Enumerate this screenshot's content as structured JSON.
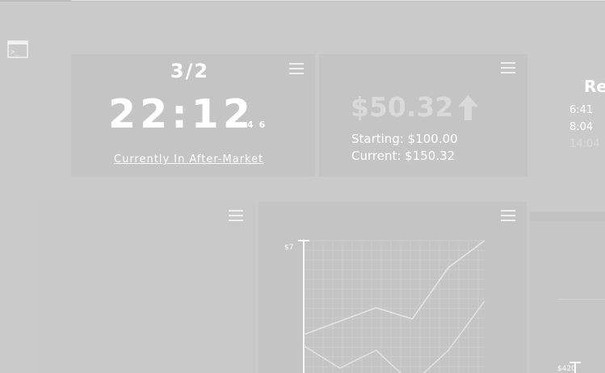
{
  "sidebar": {
    "terminal_icon": "terminal-icon"
  },
  "clock_widget": {
    "date": "3/2",
    "time": "22:12",
    "seconds": "46",
    "market_status": "Currently In After-Market",
    "menu_icon": "hamburger-menu-icon"
  },
  "portfolio_widget": {
    "change_value": "$50.32",
    "trend_icon": "up-arrow-icon",
    "starting": "Starting: $100.00",
    "current": "Current: $150.32",
    "menu_icon": "hamburger-menu-icon"
  },
  "right_panel": {
    "title": "Re",
    "times": [
      "6:41",
      "8:04",
      "14:04"
    ]
  },
  "chart_widget": {
    "menu_icon": "hamburger-menu-icon",
    "y_top_label": "$7"
  },
  "right_chart": {
    "y_label": "$420"
  },
  "chart_data": [
    {
      "type": "line",
      "x": [
        0,
        1,
        2,
        3,
        4,
        5
      ],
      "series": [
        {
          "values": [
            2.8,
            3.4,
            4.0,
            3.5,
            5.8,
            7.0
          ]
        },
        {
          "values": [
            2.3,
            1.3,
            2.1,
            0.6,
            2.1,
            4.3
          ]
        }
      ],
      "ylabel_top": "$7",
      "grid": true
    }
  ],
  "colors": {
    "background": "#cacaca",
    "card": "#c4c4c4",
    "text": "#ffffff",
    "muted_value": "#d9d9d9"
  }
}
